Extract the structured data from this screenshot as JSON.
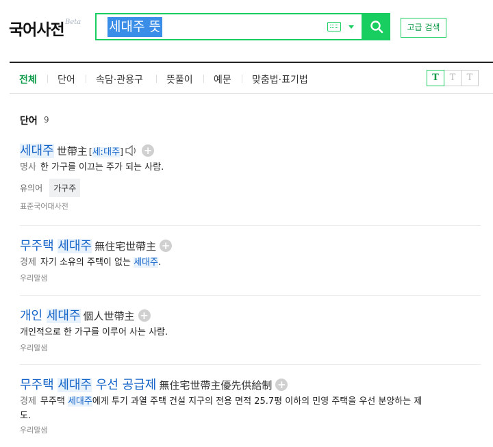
{
  "header": {
    "logo": "국어사전",
    "beta": "Beta",
    "query": "세대주 뜻",
    "advanced_search_label": "고급 검색"
  },
  "tabs": [
    {
      "label": "전체",
      "active": true
    },
    {
      "label": "단어",
      "active": false
    },
    {
      "label": "속담·관용구",
      "active": false
    },
    {
      "label": "뜻풀이",
      "active": false
    },
    {
      "label": "예문",
      "active": false
    },
    {
      "label": "맞춤법·표기법",
      "active": false
    }
  ],
  "font_size_buttons": [
    "T",
    "T",
    "T"
  ],
  "section": {
    "title": "단어",
    "count": "9"
  },
  "entries": [
    {
      "headword_pre": "",
      "headword_hl": "세대주",
      "headword_post": "",
      "hanja": "世帶主",
      "pron_open": "[",
      "pron": "세ː대주",
      "pron_close": "]",
      "pos": "명사",
      "def_pre": "한 가구를 이끄는 주가 되는 사람.",
      "def_hl": "",
      "def_post": "",
      "synonym_label": "유의어",
      "synonym": "가구주",
      "source": "표준국어대사전"
    },
    {
      "headword_pre": "무주택 ",
      "headword_hl": "세대주",
      "headword_post": "",
      "hanja": "無住宅世帶主",
      "pos": "경제",
      "def_pre": "자기 소유의 주택이 없는 ",
      "def_hl": "세대주",
      "def_post": ".",
      "source": "우리말샘"
    },
    {
      "headword_pre": "개인 ",
      "headword_hl": "세대주",
      "headword_post": "",
      "hanja": "個人世帶主",
      "pos": "",
      "def_pre": "개인적으로 한 가구를 이루어 사는 사람.",
      "def_hl": "",
      "def_post": "",
      "source": "우리말샘"
    },
    {
      "headword_pre": "무주택 ",
      "headword_hl": "세대주",
      "headword_post": " 우선 공급제",
      "hanja": "無住宅世帶主優先供給制",
      "pos": "경제",
      "def_pre": "무주택 ",
      "def_hl": "세대주",
      "def_post": "에게 투기 과열 주택 건설 지구의 전용 면적 25.7평 이하의 민영 주택을 우선 분양하는 제",
      "def_line2": "도.",
      "source": "우리말샘"
    }
  ],
  "colors": {
    "accent": "#19ce60",
    "accent_text": "#0b9a47",
    "link": "#1464c8",
    "selection": "#3a8ee8"
  }
}
